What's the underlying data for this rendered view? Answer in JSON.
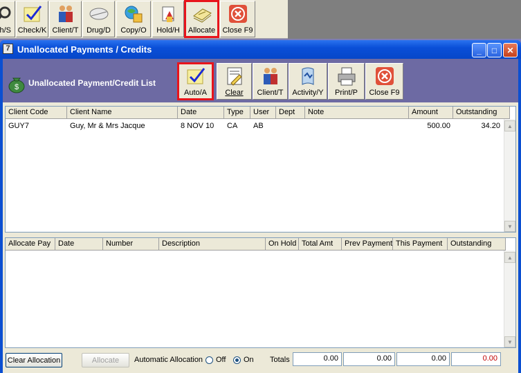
{
  "top_toolbar": {
    "buttons": [
      {
        "label": "ch/S",
        "icon": "search-icon"
      },
      {
        "label": "Check/K",
        "icon": "checkmark-icon"
      },
      {
        "label": "Client/T",
        "icon": "people-icon"
      },
      {
        "label": "Drug/D",
        "icon": "pill-icon"
      },
      {
        "label": "Copy/O",
        "icon": "copy-icon"
      },
      {
        "label": "Hold/H",
        "icon": "hold-icon"
      },
      {
        "label": "Allocate",
        "icon": "allocate-icon"
      },
      {
        "label": "Close F9",
        "icon": "close-circle-icon"
      }
    ]
  },
  "window": {
    "title": "Unallocated Payments / Credits",
    "app_icon": "7"
  },
  "band": {
    "title": "Unallocated Payment/Credit List",
    "buttons": [
      {
        "label": "Auto/A",
        "icon": "checkmark-icon"
      },
      {
        "label": "Clear",
        "icon": "clear-icon"
      },
      {
        "label": "Client/T",
        "icon": "people-icon"
      },
      {
        "label": "Activity/Y",
        "icon": "activity-icon"
      },
      {
        "label": "Print/P",
        "icon": "printer-icon"
      },
      {
        "label": "Close F9",
        "icon": "close-circle-icon"
      }
    ]
  },
  "payments_grid": {
    "headers": [
      "Client Code",
      "Client Name",
      "Date",
      "Type",
      "User",
      "Dept",
      "Note",
      "Amount",
      "Outstanding"
    ],
    "rows": [
      {
        "client_code": "GUY7",
        "client_name": "Guy, Mr & Mrs Jacque",
        "date": "8 NOV 10",
        "type": "CA",
        "user": "AB",
        "dept": "",
        "note": "",
        "amount": "500.00",
        "outstanding": "34.20"
      }
    ]
  },
  "allocation_grid": {
    "headers": [
      "Allocate Pay",
      "Date",
      "Number",
      "Description",
      "On Hold",
      "Total Amt",
      "Prev Payment",
      "This Payment",
      "Outstanding"
    ]
  },
  "footer": {
    "clear_allocation_label": "Clear Allocation",
    "allocate_label": "Allocate",
    "auto_allocation_label": "Automatic Allocation",
    "off_label": "Off",
    "on_label": "On",
    "auto_allocation_selected": "On",
    "totals_label": "Totals",
    "totals": [
      "0.00",
      "0.00",
      "0.00",
      "0.00"
    ]
  },
  "colors": {
    "highlight_frame": "#e8141c",
    "band_background": "#6d6aa3",
    "title_bar": "#0a4fd8",
    "negative_total": "#c00000"
  }
}
